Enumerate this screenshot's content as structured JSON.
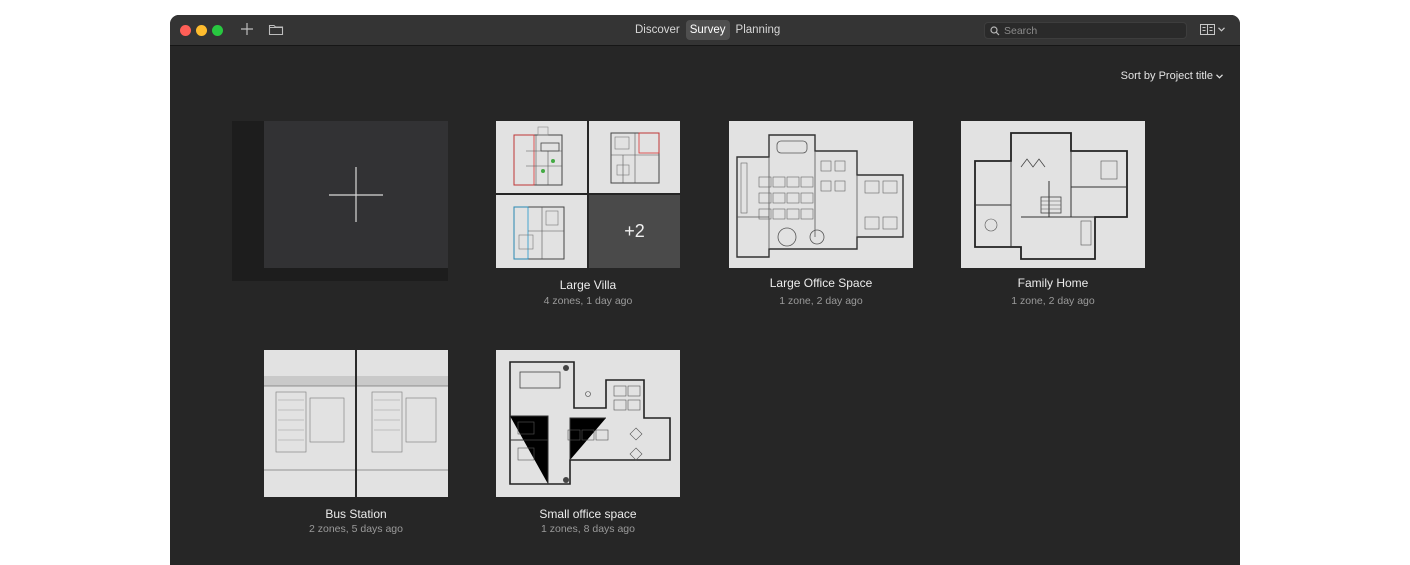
{
  "toolbar": {
    "tabs": [
      {
        "label": "Discover",
        "active": false
      },
      {
        "label": "Survey",
        "active": true
      },
      {
        "label": "Planning",
        "active": false
      }
    ],
    "search_placeholder": "Search"
  },
  "sort_label": "Sort by Project title",
  "projects": [
    {
      "title": "Large Villa",
      "subtitle": "4 zones, 1 day ago",
      "extra": "+2"
    },
    {
      "title": "Large Office Space",
      "subtitle": "1 zone, 2 day ago"
    },
    {
      "title": "Family Home",
      "subtitle": "1 zone, 2 day ago"
    },
    {
      "title": "Bus Station",
      "subtitle": "2 zones, 5 days ago"
    },
    {
      "title": "Small office space",
      "subtitle": "1 zones, 8 days ago"
    }
  ],
  "colors": {
    "accent": "#fe5f57",
    "window_bg": "#262626",
    "titlebar_bg": "#343434"
  },
  "icons": [
    "plus-icon",
    "folder-icon",
    "search-icon",
    "grid-view-icon",
    "chevron-down-icon"
  ]
}
